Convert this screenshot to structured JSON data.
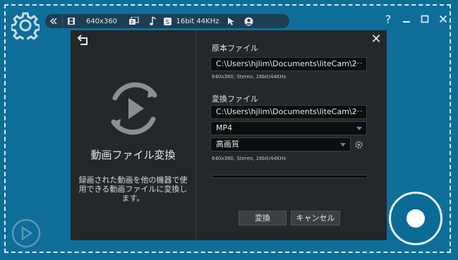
{
  "toolbar": {
    "resolution": "640x360",
    "audio": "16bit 44KHz",
    "icons": [
      "collapse-icon",
      "film-icon",
      "monitor-f-icon",
      "music-note-icon",
      "speaker-icon",
      "cursor-icon",
      "webcam-icon"
    ]
  },
  "window": {
    "help": "?",
    "minimize": "—",
    "maximize": "☐",
    "close": "✕"
  },
  "dialog": {
    "left": {
      "title": "動画ファイル変換",
      "description": "録画された動画を他の機器で使用できる動画ファイルに変換します。"
    },
    "close": "✕",
    "source_label": "原本ファイル",
    "source_path": "C:\\Users\\hjlim\\Documents\\liteCam\\2",
    "source_info": "640x360, Stereo, 16bit/44KHz",
    "target_label": "変換ファイル",
    "target_path": "C:\\Users\\hjlim\\Documents\\liteCam\\2",
    "format_value": "MP4",
    "quality_value": "高画質",
    "target_info": "640x360, Stereo, 16bit/44KHz",
    "progress": 0,
    "convert_button": "変換",
    "cancel_button": "キャンセル",
    "browse_dots": "···"
  },
  "colors": {
    "background": "#0e6e99",
    "dialog": "#222729",
    "accent": "#4d8dc8"
  }
}
